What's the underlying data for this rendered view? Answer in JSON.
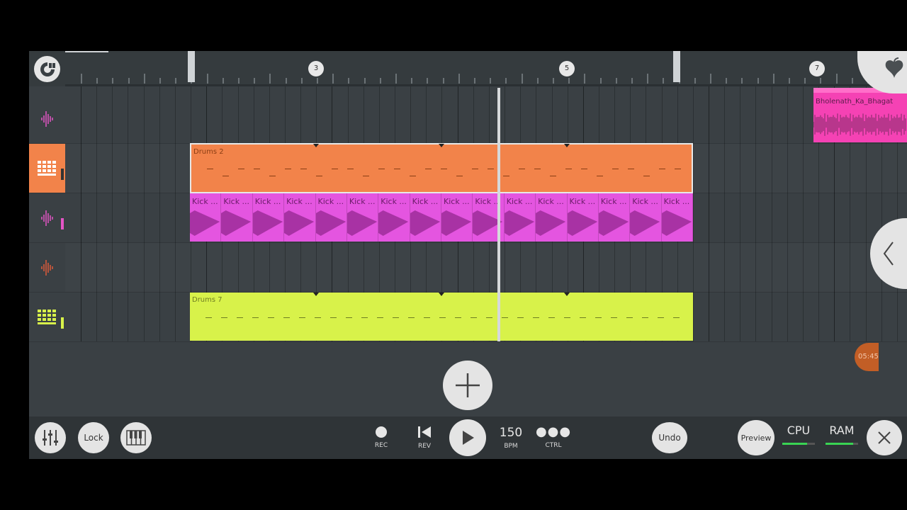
{
  "ruler": {
    "bar_numbers": [
      "3",
      "5",
      "7"
    ]
  },
  "tracks": [
    {
      "id": "audio-1",
      "icon": "waveform-icon",
      "icon_color": "#e455c6",
      "indicator_color": null
    },
    {
      "id": "drums-2",
      "icon": "step-sequencer-icon",
      "icon_color": "#ffffff",
      "selected": true,
      "indicator_color": "#333333"
    },
    {
      "id": "audio-3",
      "icon": "waveform-icon",
      "icon_color": "#e455c6",
      "indicator_color": "#e455c6"
    },
    {
      "id": "audio-4",
      "icon": "waveform-icon",
      "icon_color": "#e05a3a",
      "indicator_color": null
    },
    {
      "id": "drums-7",
      "icon": "step-sequencer-icon",
      "icon_color": "#d8f24a",
      "indicator_color": "#d8f24a"
    }
  ],
  "clips": {
    "bholenath": {
      "name": "Bholenath_Ka_Bhagat",
      "color": "#f542b4"
    },
    "drums2": {
      "name": "Drums 2",
      "color": "#f2834a"
    },
    "kick": {
      "name": "Kick ...",
      "color": "#e455e0",
      "count": 16
    },
    "drums7": {
      "name": "Drums 7",
      "color": "#d8f24a"
    }
  },
  "time_badge": "05:45",
  "toolbar": {
    "lock_label": "Lock",
    "rec_label": "REC",
    "rev_label": "REV",
    "bpm_value": "150",
    "bpm_label": "BPM",
    "ctrl_label": "CTRL",
    "undo_label": "Undo",
    "preview_label": "Preview",
    "cpu_label": "CPU",
    "ram_label": "RAM",
    "cpu_level": 0.75,
    "ram_level": 0.85,
    "meter_color": "#39d353"
  }
}
